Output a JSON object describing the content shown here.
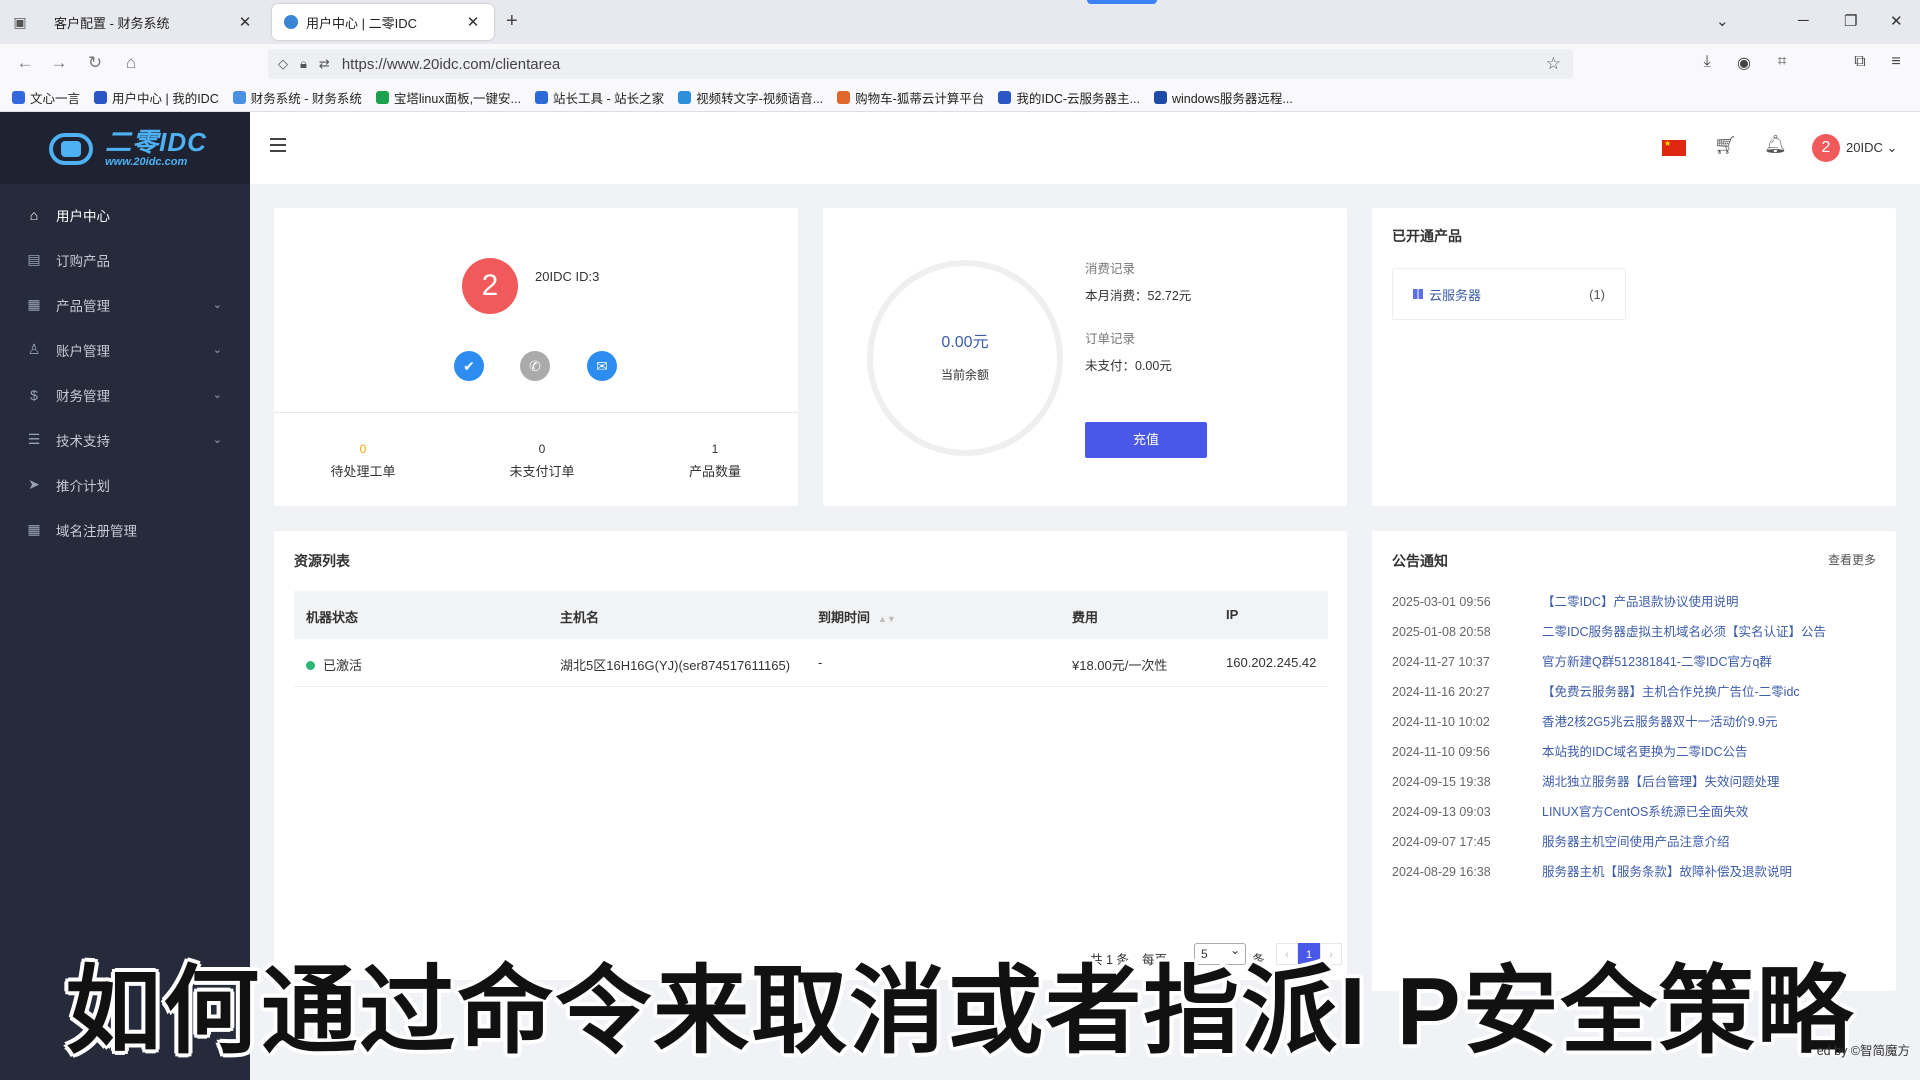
{
  "browser": {
    "tabs": [
      {
        "title": "客户配置 - 财务系统"
      },
      {
        "title": "用户中心 | 二零IDC"
      }
    ],
    "new_tab": "+",
    "url": "https://www.20idc.com/clientarea",
    "bookmarks": [
      {
        "label": "文心一言",
        "color": "#3468e0"
      },
      {
        "label": "用户中心 | 我的IDC",
        "color": "#2a56c6"
      },
      {
        "label": "财务系统 - 财务系统",
        "color": "#4a90e2"
      },
      {
        "label": "宝塔linux面板,一键安...",
        "color": "#1aa14e"
      },
      {
        "label": "站长工具 - 站长之家",
        "color": "#2d6ad9"
      },
      {
        "label": "视频转文字-视频语音...",
        "color": "#2b8fd9"
      },
      {
        "label": "购物车-狐蒂云计算平台",
        "color": "#e0672a"
      },
      {
        "label": "我的IDC-云服务器主...",
        "color": "#2a56c6"
      },
      {
        "label": "windows服务器远程...",
        "color": "#1e4ba8"
      }
    ]
  },
  "sidebar": {
    "logo_text": "二零IDC",
    "logo_sub": "www.20idc.com",
    "items": [
      {
        "label": "用户中心",
        "icon": "home-icon",
        "glyph": "⌂",
        "active": true,
        "expandable": false
      },
      {
        "label": "订购产品",
        "icon": "store-icon",
        "glyph": "▤",
        "active": false,
        "expandable": false
      },
      {
        "label": "产品管理",
        "icon": "grid-icon",
        "glyph": "▦",
        "active": false,
        "expandable": true
      },
      {
        "label": "账户管理",
        "icon": "user-icon",
        "glyph": "♙",
        "active": false,
        "expandable": true
      },
      {
        "label": "财务管理",
        "icon": "dollar-icon",
        "glyph": "$",
        "active": false,
        "expandable": true
      },
      {
        "label": "技术支持",
        "icon": "support-icon",
        "glyph": "☰",
        "active": false,
        "expandable": true
      },
      {
        "label": "推介计划",
        "icon": "send-icon",
        "glyph": "➤",
        "active": false,
        "expandable": false
      },
      {
        "label": "域名注册管理",
        "icon": "domain-icon",
        "glyph": "▦",
        "active": false,
        "expandable": false
      }
    ]
  },
  "header": {
    "avatar_letter": "2",
    "username": "20IDC",
    "username_caret": "⌄"
  },
  "profile": {
    "avatar_letter": "2",
    "user_id": "20IDC ID:3",
    "stats": [
      {
        "value": "0",
        "label": "待处理工单"
      },
      {
        "value": "0",
        "label": "未支付订单"
      },
      {
        "value": "1",
        "label": "产品数量"
      }
    ]
  },
  "balance": {
    "amount": "0.00元",
    "label": "当前余额",
    "consume_title": "消费记录",
    "consume_value": "本月消费：52.72元",
    "order_title": "订单记录",
    "order_value": "未支付：0.00元",
    "recharge_label": "充值"
  },
  "products": {
    "title": "已开通产品",
    "items": [
      {
        "name": "云服务器",
        "count": "(1)"
      }
    ]
  },
  "resources": {
    "title": "资源列表",
    "columns": [
      "机器状态",
      "主机名",
      "到期时间",
      "费用",
      "IP"
    ],
    "rows": [
      {
        "status": "已激活",
        "hostname": "湖北5区16H16G(YJ)(ser874517611165)",
        "expiry": "-",
        "fee": "¥18.00元/一次性",
        "ip": "160.202.245.42"
      }
    ],
    "pager": {
      "total": "共 1 条",
      "per_page_label": "每页",
      "per_page_value": "5",
      "unit": "条",
      "prev": "‹",
      "current": "1",
      "next": "›"
    }
  },
  "notices": {
    "title": "公告通知",
    "more": "查看更多",
    "items": [
      {
        "date": "2025-03-01 09:56",
        "title": "【二零IDC】产品退款协议使用说明"
      },
      {
        "date": "2025-01-08 20:58",
        "title": "二零IDC服务器虚拟主机域名必须【实名认证】公告"
      },
      {
        "date": "2024-11-27 10:37",
        "title": "官方新建Q群512381841-二零IDC官方q群"
      },
      {
        "date": "2024-11-16 20:27",
        "title": "【免费云服务器】主机合作兑换广告位-二零idc"
      },
      {
        "date": "2024-11-10 10:02",
        "title": "香港2核2G5兆云服务器双十一活动价9.9元"
      },
      {
        "date": "2024-11-10 09:56",
        "title": "本站我的IDC域名更换为二零IDC公告"
      },
      {
        "date": "2024-09-15 19:38",
        "title": "湖北独立服务器【后台管理】失效问题处理"
      },
      {
        "date": "2024-09-13 09:03",
        "title": "LINUX官方CentOS系统源已全面失效"
      },
      {
        "date": "2024-09-07 17:45",
        "title": "服务器主机空间使用产品注意介绍"
      },
      {
        "date": "2024-08-29 16:38",
        "title": "服务器主机【服务条款】故障补偿及退款说明"
      }
    ]
  },
  "overlay": {
    "subtitle": "如何通过命令来取消或者指派I P安全策略",
    "credit": "ed by ©智简魔方"
  },
  "colors": {
    "sidebar_bg": "#262b3b",
    "accent": "#4958e6",
    "link": "#3d5caa",
    "avatar": "#f05a5a",
    "active_status": "#2bb673"
  }
}
